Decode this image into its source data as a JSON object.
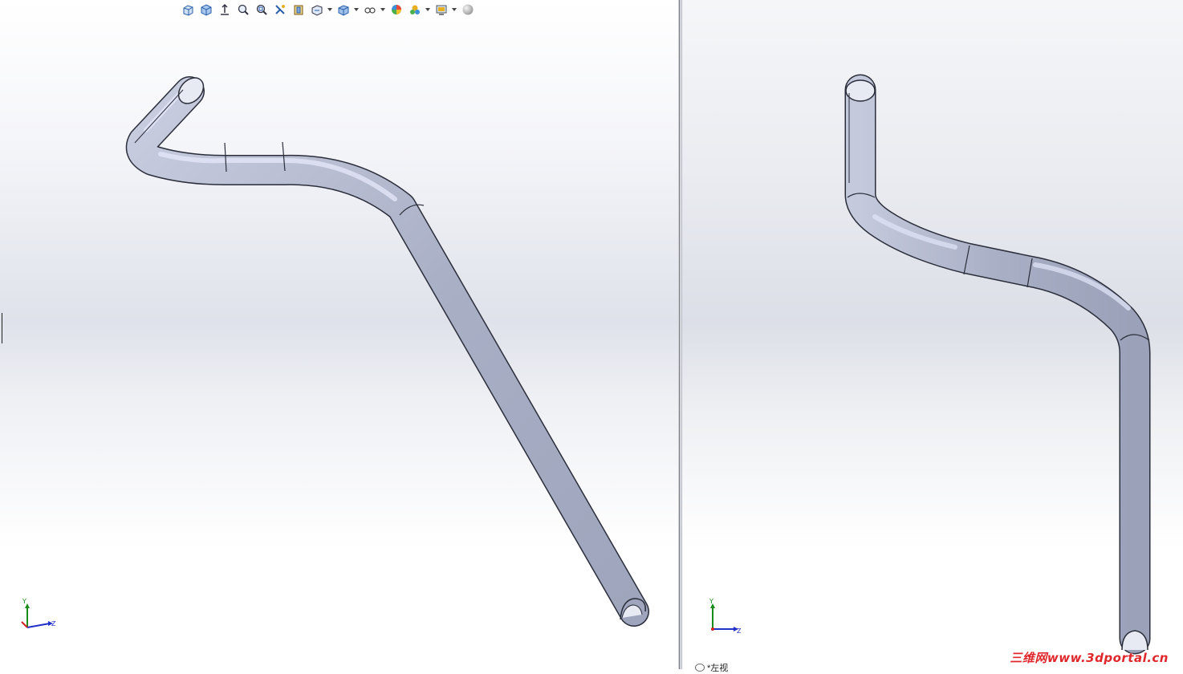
{
  "toolbar": {
    "items": [
      {
        "icon": "view-orientation-icon"
      },
      {
        "icon": "normal-to-icon"
      },
      {
        "icon": "previous-view-icon"
      },
      {
        "icon": "zoom-to-fit-icon"
      },
      {
        "icon": "zoom-to-area-icon"
      },
      {
        "icon": "section-view-icon"
      },
      {
        "icon": "view-selector-icon"
      },
      {
        "icon": "display-style-icon"
      },
      {
        "icon": "hide-show-items-icon"
      },
      {
        "icon": "edit-appearance-icon"
      },
      {
        "icon": "apply-scene-icon"
      },
      {
        "icon": "view-settings-icon"
      },
      {
        "icon": "realview-sphere-icon"
      }
    ]
  },
  "left_viewport": {
    "triad": {
      "y_label": "Y",
      "z_label": "Z"
    }
  },
  "right_viewport": {
    "triad": {
      "y_label": "Y",
      "z_label": "Z"
    },
    "view_name": "*左视"
  },
  "watermark": {
    "text": "三维网www.3dportal.cn"
  },
  "colors": {
    "tube_fill": "#aab0c6",
    "tube_highlight": "#dde1f5",
    "tube_edge": "#2a2d3a",
    "triad_x": "#d22020",
    "triad_y": "#1a8a1a",
    "triad_z": "#2030c8",
    "watermark": "#e0282c"
  }
}
